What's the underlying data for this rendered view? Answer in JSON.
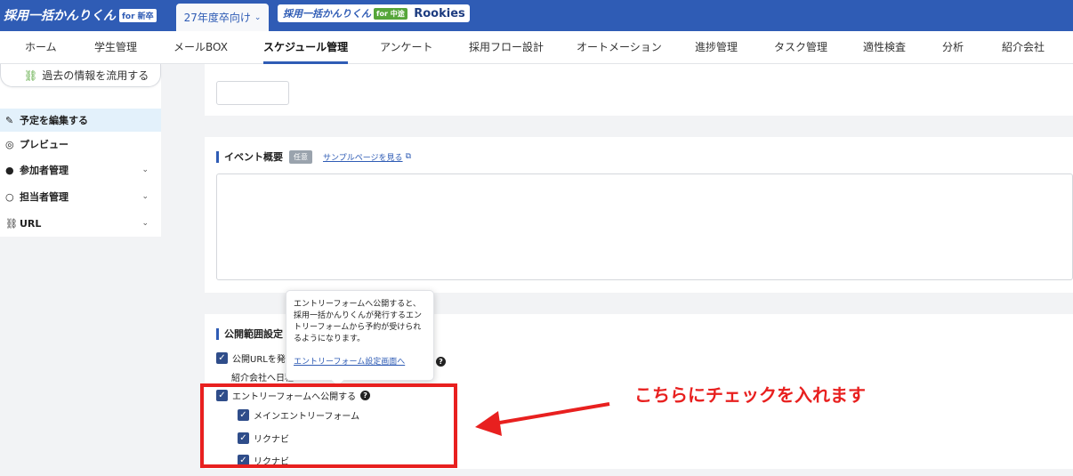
{
  "header": {
    "logo_main": "採用一括かんりくん",
    "logo_main_tag": "for 新卒",
    "year_selector": "27年度卒向け",
    "logo_mid": "採用一括かんりくん",
    "logo_mid_tag": "for 中途",
    "logo_rookies": "Rookies"
  },
  "nav": {
    "items": [
      "ホーム",
      "学生管理",
      "メールBOX",
      "スケジュール管理",
      "アンケート",
      "採用フロー設計",
      "オートメーション",
      "進捗管理",
      "タスク管理",
      "適性検査",
      "分析",
      "紹介会社"
    ],
    "active_index": 3
  },
  "sidebar": {
    "reuse_button": "過去の情報を流用する",
    "items": [
      {
        "label": "予定を編集する",
        "icon": "pencil-icon",
        "active": true
      },
      {
        "label": "プレビュー",
        "icon": "eye-icon",
        "active": false
      },
      {
        "label": "参加者管理",
        "icon": "users-icon",
        "active": false
      },
      {
        "label": "担当者管理",
        "icon": "person-icon",
        "active": false
      },
      {
        "label": "URL",
        "icon": "link-icon",
        "active": false
      }
    ]
  },
  "event_overview": {
    "title": "イベント概要",
    "badge": "任意",
    "sample_link": "サンプルページを見る"
  },
  "publish_settings": {
    "title": "公開範囲設定",
    "publish_url_label": "公開URLを発行",
    "agency_label": "紹介会社へ日程",
    "entry_form_label": "エントリーフォームへ公開する",
    "sub_options": [
      "メインエントリーフォーム",
      "リクナビ",
      "リクナビ"
    ]
  },
  "tooltip": {
    "text": "エントリーフォームへ公開すると、採用一括かんりくんが発行するエントリーフォームから予約が受けられるようになります。",
    "link": "エントリーフォーム設定画面へ"
  },
  "annotation": {
    "text": "こちらにチェックを入れます",
    "color": "#e8201f"
  },
  "colors": {
    "brand": "#2f5cb5",
    "checkbox": "#2f4d8a"
  }
}
